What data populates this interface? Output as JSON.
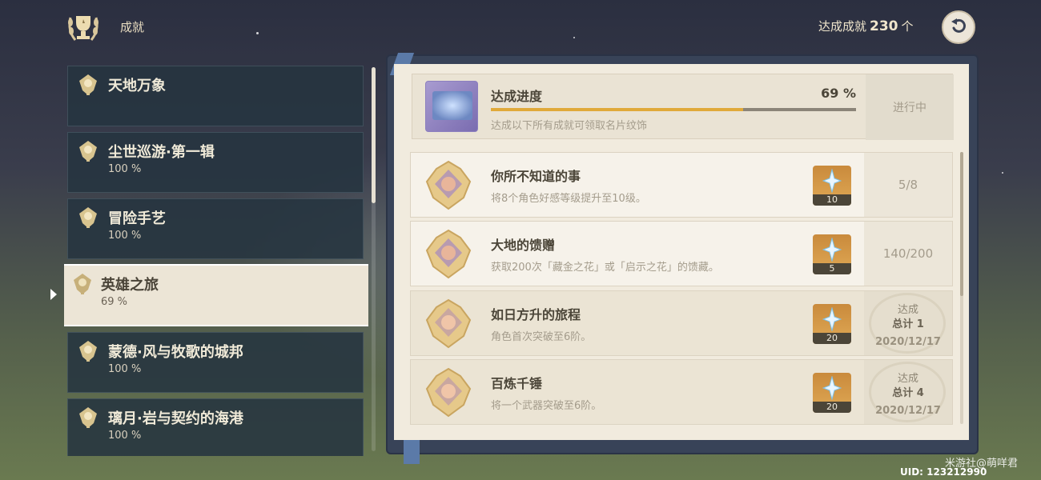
{
  "header": {
    "title": "成就",
    "total_label": "达成成就",
    "total_value": "230",
    "total_unit": "个"
  },
  "sidebar": {
    "items": [
      {
        "name": "天地万象",
        "percent": ""
      },
      {
        "name": "尘世巡游·第一辑",
        "percent": "100 %"
      },
      {
        "name": "冒险手艺",
        "percent": "100 %"
      },
      {
        "name": "英雄之旅",
        "percent": "69 %"
      },
      {
        "name": "蒙德·风与牧歌的城邦",
        "percent": "100 %"
      },
      {
        "name": "璃月·岩与契约的海港",
        "percent": "100 %"
      }
    ],
    "active_index": 3
  },
  "progress": {
    "label": "达成进度",
    "percent_text": "69 %",
    "value": 0.69,
    "description": "达成以下所有成就可领取名片纹饰",
    "status": "进行中"
  },
  "achievements": [
    {
      "title": "你所不知道的事",
      "description": "将8个角色好感等级提升至10级。",
      "reward_qty": "10",
      "progress": "5/8",
      "completed": false
    },
    {
      "title": "大地的馈赠",
      "description": "获取200次「藏金之花」或「启示之花」的馈藏。",
      "reward_qty": "5",
      "progress": "140/200",
      "completed": false
    },
    {
      "title": "如日方升的旅程",
      "description": "角色首次突破至6阶。",
      "reward_qty": "20",
      "stamp_top": "达成",
      "stamp_count": "总计 1",
      "stamp_date": "2020/12/17",
      "completed": true
    },
    {
      "title": "百炼千锤",
      "description": "将一个武器突破至6阶。",
      "reward_qty": "20",
      "stamp_top": "达成",
      "stamp_count": "总计 4",
      "stamp_date": "2020/12/17",
      "completed": true
    }
  ],
  "footer": {
    "watermark": "米游社@萌咩君",
    "uid": "UID: 123212990"
  },
  "colors": {
    "accent_gold": "#e0a93a",
    "panel_bg": "#f1ebde",
    "sidebar_item_bg": "#263440",
    "text_dark": "#4b4538",
    "text_muted": "#a49c8c"
  },
  "icons": {
    "header": "trophy-wreath-icon",
    "back": "back-arrow-icon",
    "category": "achievement-badge-icon",
    "reward": "primogem-icon",
    "medal": "achievement-medal-icon"
  }
}
